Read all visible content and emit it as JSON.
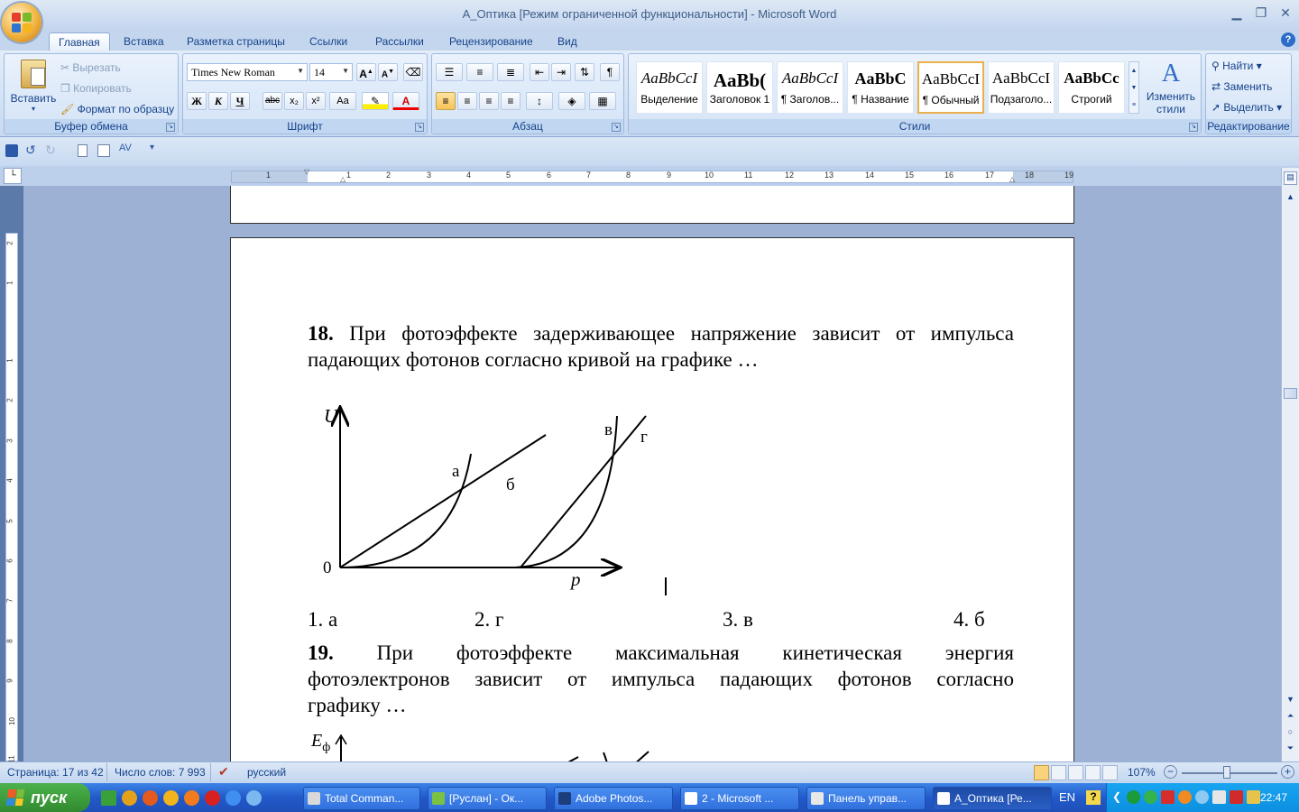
{
  "window": {
    "title": "А_Оптика [Режим ограниченной функциональности] - Microsoft Word"
  },
  "tabs": [
    "Главная",
    "Вставка",
    "Разметка страницы",
    "Ссылки",
    "Рассылки",
    "Рецензирование",
    "Вид"
  ],
  "clipboard": {
    "paste": "Вставить",
    "cut": "Вырезать",
    "copy": "Копировать",
    "format_painter": "Формат по образцу",
    "label": "Буфер обмена"
  },
  "font": {
    "name": "Times New Roman",
    "size": "14",
    "label": "Шрифт",
    "bold": "Ж",
    "italic": "К",
    "underline": "Ч",
    "strike": "abc",
    "sub": "x₂",
    "sup": "x²",
    "case": "Aa",
    "color_letter": "A"
  },
  "paragraph": {
    "label": "Абзац"
  },
  "styles": {
    "label": "Стили",
    "items": [
      {
        "sample": "AaBbCcI",
        "name": "Выделение"
      },
      {
        "sample": "AaBb(",
        "name": "Заголовок 1"
      },
      {
        "sample": "AaBbCcI",
        "name": "¶ Заголов..."
      },
      {
        "sample": "AaBbC",
        "name": "¶ Название"
      },
      {
        "sample": "AaBbCcI",
        "name": "¶ Обычный"
      },
      {
        "sample": "AaBbCcI",
        "name": "Подзаголо..."
      },
      {
        "sample": "AaBbCc",
        "name": "Строгий"
      }
    ],
    "change": "Изменить стили"
  },
  "editing": {
    "find": "Найти",
    "replace": "Заменить",
    "select": "Выделить",
    "label": "Редактирование"
  },
  "ruler": {
    "numbers": [
      "1",
      "1",
      "2",
      "3",
      "4",
      "5",
      "6",
      "7",
      "8",
      "9",
      "10",
      "11",
      "12",
      "13",
      "14",
      "15",
      "16",
      "17",
      "18",
      "19"
    ],
    "vnumbers": [
      "2",
      "1",
      "1",
      "1",
      "2",
      "3",
      "4",
      "5",
      "6",
      "7",
      "8",
      "9",
      "10",
      "11"
    ]
  },
  "document": {
    "q18_num": "18.",
    "q18_text": "При фотоэффекте задерживающее напряжение зависит от импульса падающих фотонов согласно кривой на графике …",
    "q18_line1": "При фотоэффекте задерживающее напряжение зависит от импульса",
    "q18_line2": "падающих фотонов согласно кривой на графике …",
    "graph": {
      "y_axis": "U",
      "x_axis": "p",
      "origin": "0",
      "curves": [
        "а",
        "б",
        "в",
        "г"
      ]
    },
    "answers": [
      "1. а",
      "2. г",
      "3. в",
      "4. б"
    ],
    "q19_num": "19.",
    "q19_line1": "При фотоэффекте максимальная кинетическая энергия",
    "q19_line2": "фотоэлектронов зависит от импульса падающих фотонов согласно",
    "q19_line3": "графику …",
    "graph2": {
      "y_axis": "E",
      "y_sub": "ф"
    }
  },
  "status": {
    "page": "Страница: 17 из 42",
    "words": "Число слов: 7 993",
    "lang": "русский",
    "zoom": "107%"
  },
  "taskbar": {
    "start": "пуск",
    "items": [
      "Total Comman...",
      "[Руслан] - Ок...",
      "Adobe Photos...",
      "2 - Microsoft ...",
      "Панель управ...",
      "А_Оптика [Ре..."
    ],
    "lang": "EN",
    "clock": "22:47"
  },
  "colors": {
    "ribbon": "#c7d9f1",
    "accent": "#15428b",
    "taskbar": "#2259c9",
    "start": "#3c9b3c"
  }
}
